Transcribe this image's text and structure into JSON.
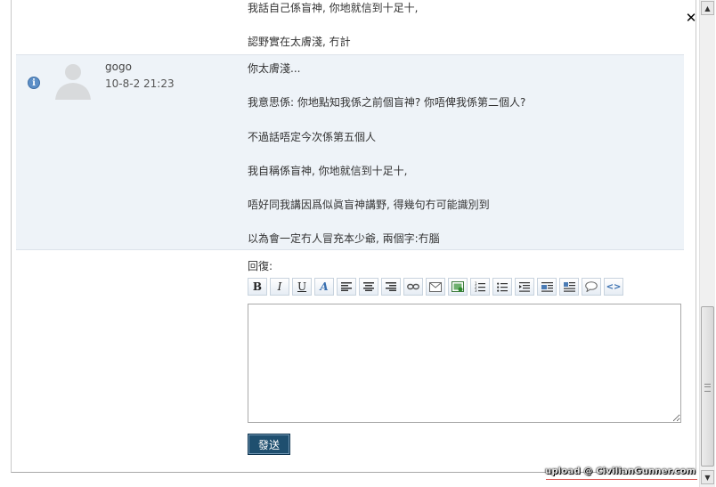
{
  "thread": {
    "prev_lines": [
      "我話自己係盲神, 你地就信到十足十,",
      "認野實在太膚淺, 冇計"
    ],
    "post": {
      "username": "gogo",
      "time": "10-8-2 21:23",
      "lines": [
        "你太膚淺...",
        "我意思係: 你地點知我係之前個盲神? 你唔俾我係第二個人?",
        "不過話唔定今次係第五個人",
        "我自稱係盲神, 你地就信到十足十,",
        "唔好同我講因爲似眞盲神講野, 得幾句冇可能識別到",
        "以為會一定冇人冒充本少爺, 兩個字:冇腦"
      ]
    }
  },
  "reply": {
    "label": "回復:",
    "send_label": "發送",
    "editor_value": ""
  },
  "toolbar": {
    "bold": "B",
    "italic": "I",
    "underline": "U",
    "font_color": "A",
    "source": "<>"
  },
  "watermark": "upload @ CivilianGunner.com",
  "colors": {
    "post_bg": "#eef3f8",
    "send_button": "#1f4f6f",
    "info_icon": "#5d8fc7"
  }
}
